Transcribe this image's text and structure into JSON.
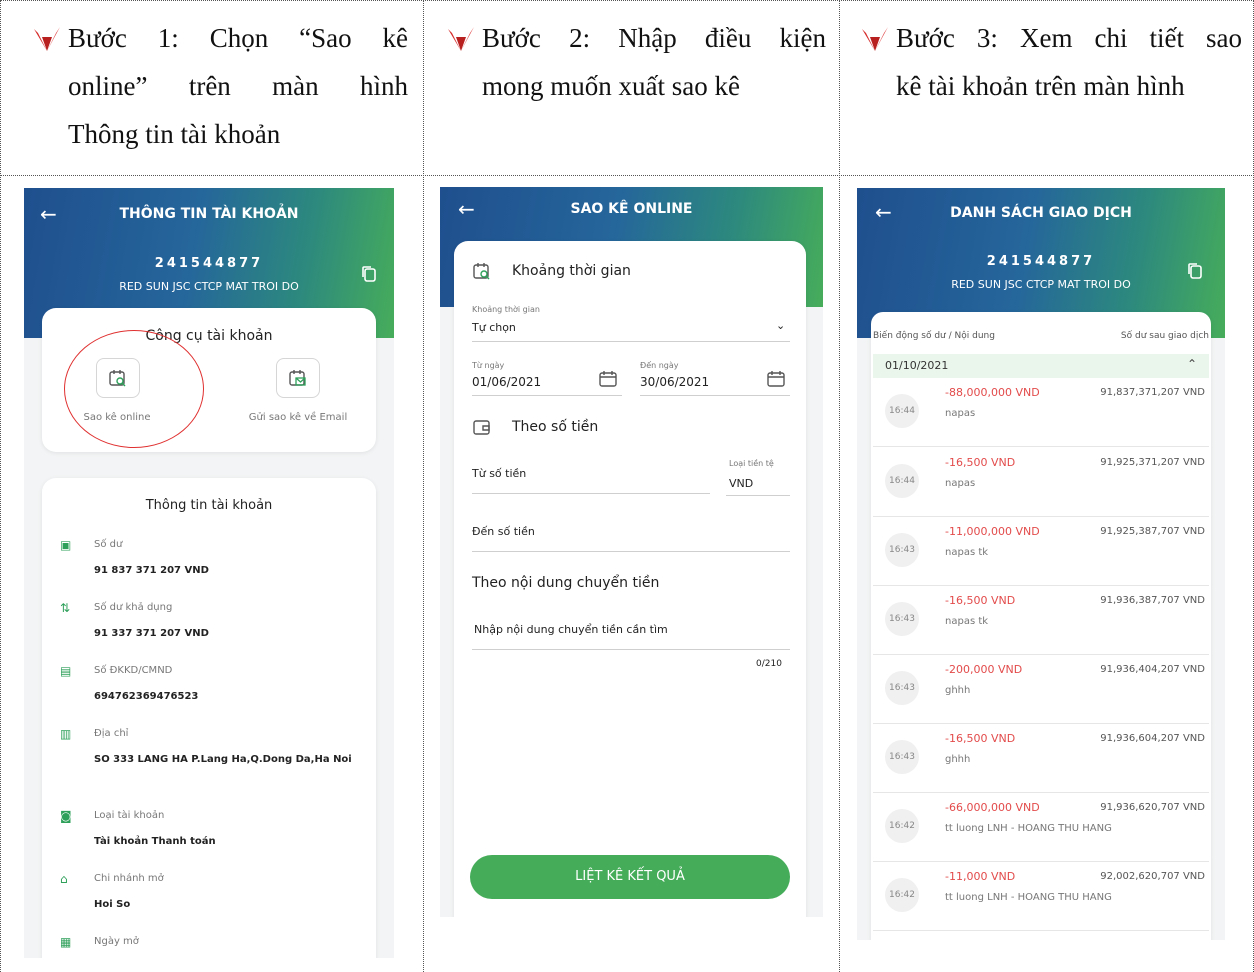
{
  "colors": {
    "green": "#45ad5a",
    "red": "#e34b4b",
    "banner_blue": "#1f4f8e",
    "bullet_red": "#d62a2a"
  },
  "steps": [
    {
      "line1": "Bước 1: Chọn “Sao kê",
      "line2": "online” trên màn hình",
      "line3": "Thông tin tài khoản"
    },
    {
      "line1": "Bước 2: Nhập điều kiện",
      "line2": "mong muốn xuất sao kê"
    },
    {
      "line1": "Bước 3: Xem chi tiết sao",
      "line2": "kê tài khoản trên màn hình"
    }
  ],
  "screen1": {
    "back_icon": "←",
    "title": "THÔNG TIN TÀI KHOẢN",
    "account_number": "241544877",
    "account_name": "RED SUN JSC CTCP MAT TROI DO",
    "tools_title": "Công cụ tài khoản",
    "tool_online_label": "Sao kê online",
    "tool_email_label": "Gửi sao kê về Email",
    "info_title": "Thông tin tài khoản",
    "info_items": [
      {
        "icon": "money-icon",
        "label": "Số dư",
        "value": "91 837 371 207 VND"
      },
      {
        "icon": "transfer-arrows-icon",
        "label": "Số dư khả dụng",
        "value": "91 337 371 207 VND"
      },
      {
        "icon": "id-card-icon",
        "label": "Số ĐKKD/CMND",
        "value": "694762369476523"
      },
      {
        "icon": "building-icon",
        "label": "Địa chỉ",
        "value": "SO 333 LANG HA P.Lang Ha,Q.Dong Da,Ha Noi"
      },
      {
        "icon": "wallet-icon",
        "label": "Loại tài khoản",
        "value": "Tài khoản Thanh toán"
      },
      {
        "icon": "bank-icon",
        "label": "Chi nhánh mở",
        "value": "Hoi So"
      },
      {
        "icon": "calendar-icon",
        "label": "Ngày mở",
        "value": ""
      }
    ]
  },
  "screen2": {
    "back_icon": "←",
    "title": "SAO KÊ ONLINE",
    "section_time": "Khoảng thời gian",
    "period_label": "Khoảng thời gian",
    "period_value": "Tự chọn",
    "from_date_label": "Từ ngày",
    "from_date_value": "01/06/2021",
    "to_date_label": "Đến ngày",
    "to_date_value": "30/06/2021",
    "section_amount": "Theo số tiền",
    "from_amount_placeholder": "Từ số tiền",
    "currency_label": "Loại tiền tệ",
    "currency_value": "VND",
    "to_amount_placeholder": "Đến số tiền",
    "section_content": "Theo nội dung chuyển tiền",
    "content_placeholder": "Nhập nội dung chuyển tiền cần tìm",
    "char_counter": "0/210",
    "submit_label": "LIỆT KÊ KẾT QUẢ"
  },
  "screen3": {
    "back_icon": "←",
    "title": "DANH SÁCH GIAO DỊCH",
    "account_number": "241544877",
    "account_name": "RED SUN JSC CTCP MAT TROI DO",
    "col_left": "Biến động số dư / Nội dung",
    "col_right": "Số dư sau giao dịch",
    "date": "01/10/2021",
    "transactions": [
      {
        "time": "16:44",
        "amount": "-88,000,000 VND",
        "balance": "91,837,371,207 VND",
        "desc": "napas"
      },
      {
        "time": "16:44",
        "amount": "-16,500 VND",
        "balance": "91,925,371,207 VND",
        "desc": "napas"
      },
      {
        "time": "16:43",
        "amount": "-11,000,000 VND",
        "balance": "91,925,387,707 VND",
        "desc": "napas tk"
      },
      {
        "time": "16:43",
        "amount": "-16,500 VND",
        "balance": "91,936,387,707 VND",
        "desc": "napas tk"
      },
      {
        "time": "16:43",
        "amount": "-200,000 VND",
        "balance": "91,936,404,207 VND",
        "desc": "ghhh"
      },
      {
        "time": "16:43",
        "amount": "-16,500 VND",
        "balance": "91,936,604,207 VND",
        "desc": "ghhh"
      },
      {
        "time": "16:42",
        "amount": "-66,000,000 VND",
        "balance": "91,936,620,707 VND",
        "desc": "tt luong LNH - HOANG THU HANG"
      },
      {
        "time": "16:42",
        "amount": "-11,000 VND",
        "balance": "92,002,620,707 VND",
        "desc": "tt luong LNH - HOANG THU HANG"
      }
    ]
  }
}
